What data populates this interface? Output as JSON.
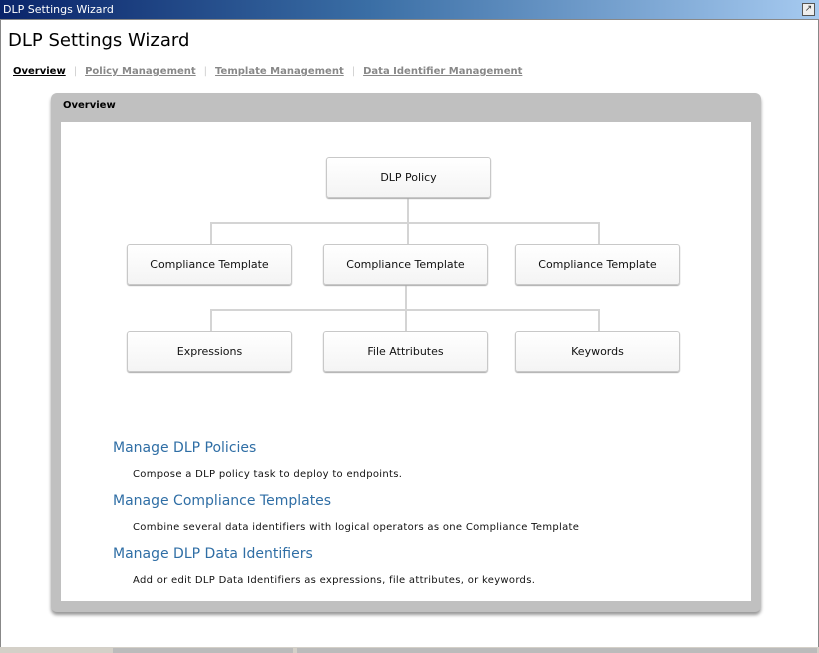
{
  "window": {
    "title": "DLP Settings Wizard"
  },
  "page_title": "DLP Settings Wizard",
  "tabs": [
    {
      "label": "Overview"
    },
    {
      "label": "Policy Management"
    },
    {
      "label": "Template Management"
    },
    {
      "label": "Data Identifier Management"
    }
  ],
  "panel": {
    "title": "Overview"
  },
  "diagram": {
    "root": "DLP Policy",
    "templates": [
      "Compliance Template",
      "Compliance Template",
      "Compliance Template"
    ],
    "identifiers": [
      "Expressions",
      "File Attributes",
      "Keywords"
    ]
  },
  "sections": [
    {
      "title": "Manage DLP Policies",
      "description": "Compose a DLP policy task to deploy to endpoints."
    },
    {
      "title": "Manage Compliance Templates",
      "description": "Combine several data identifiers with logical operators as one Compliance Template"
    },
    {
      "title": "Manage DLP Data Identifiers",
      "description": "Add or edit DLP Data Identifiers as expressions, file attributes, or keywords."
    }
  ]
}
